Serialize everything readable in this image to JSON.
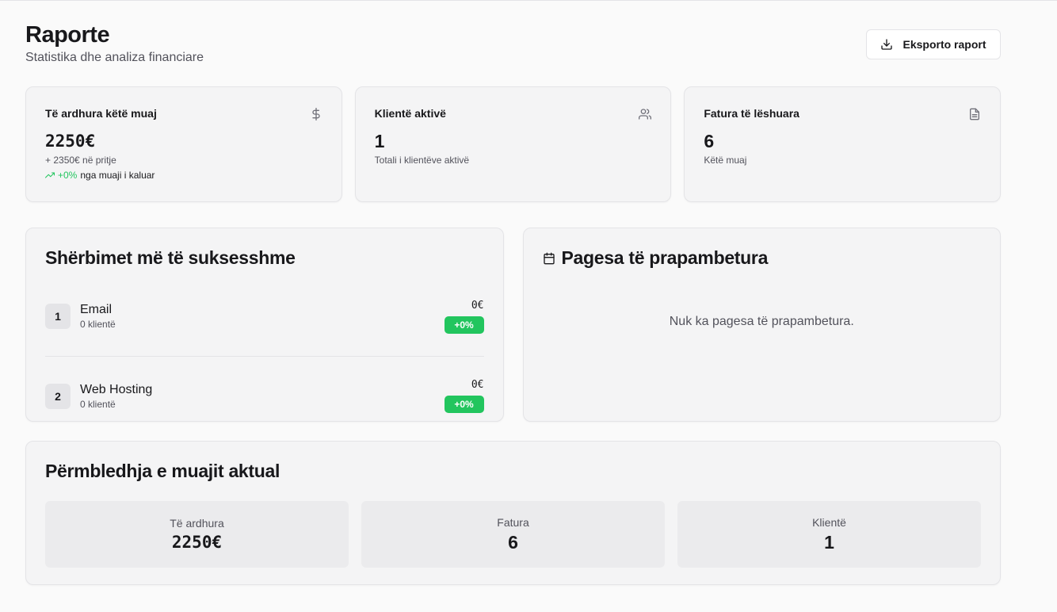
{
  "header": {
    "title": "Raporte",
    "subtitle": "Statistika dhe analiza financiare",
    "export_label": "Eksporto raport",
    "export_icon": "download-icon"
  },
  "stats": [
    {
      "label": "Të ardhura këtë muaj",
      "value": "2250€",
      "sub": "+ 2350€ në pritje",
      "trend_value": "+0%",
      "trend_text": "nga muaji i kaluar",
      "icon": "dollar-icon"
    },
    {
      "label": "Klientë aktivë",
      "value": "1",
      "sub": "Totali i klientëve aktivë",
      "icon": "users-icon"
    },
    {
      "label": "Fatura të lëshuara",
      "value": "6",
      "sub": "Këtë muaj",
      "icon": "file-text-icon"
    }
  ],
  "services": {
    "title": "Shërbimet më të suksesshme",
    "items": [
      {
        "rank": "1",
        "name": "Email",
        "clients": "0 klientë",
        "amount": "0€",
        "badge": "+0%"
      },
      {
        "rank": "2",
        "name": "Web Hosting",
        "clients": "0 klientë",
        "amount": "0€",
        "badge": "+0%"
      }
    ]
  },
  "overdue": {
    "title": "Pagesa të prapambetura",
    "icon": "calendar-icon",
    "empty_text": "Nuk ka pagesa të prapambetura."
  },
  "summary": {
    "title": "Përmbledhja e muajit aktual",
    "items": [
      {
        "label": "Të ardhura",
        "value": "2250€"
      },
      {
        "label": "Fatura",
        "value": "6"
      },
      {
        "label": "Klientë",
        "value": "1"
      }
    ]
  },
  "colors": {
    "accent_green": "#22c55e",
    "card_bg": "#f4f4f5",
    "border": "#e4e4e7"
  }
}
